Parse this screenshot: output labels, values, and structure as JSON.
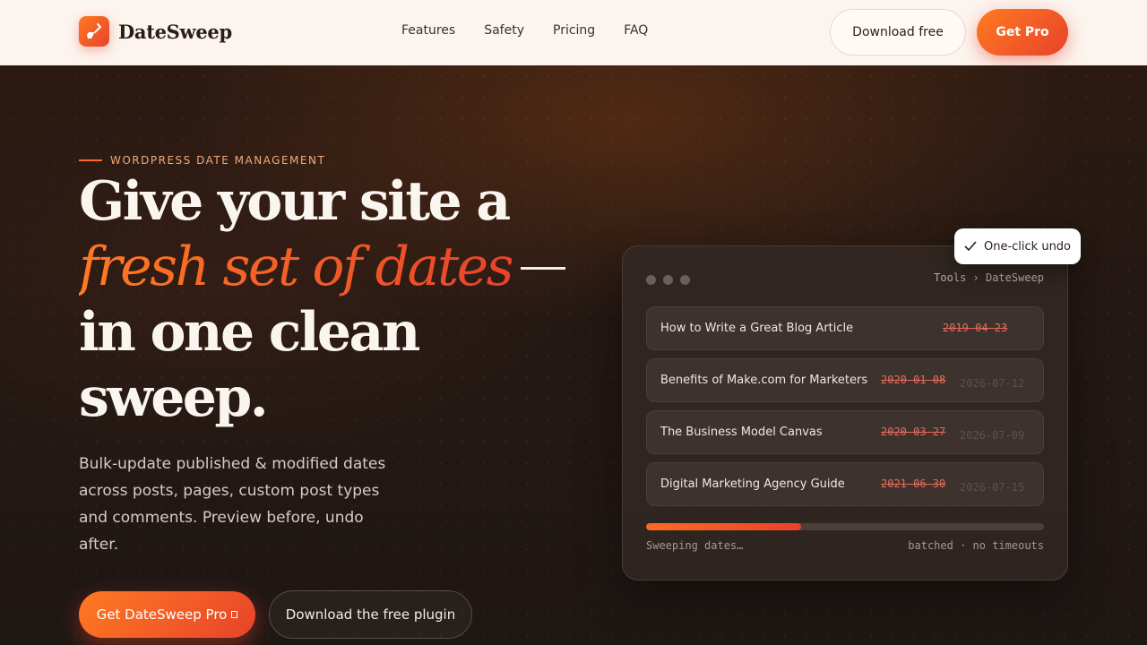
{
  "nav": {
    "brand": "DateSweep",
    "links": [
      "Features",
      "Safety",
      "Pricing",
      "FAQ"
    ],
    "download_label": "Download free",
    "pro_label": "Get Pro"
  },
  "hero": {
    "eyebrow": "WORDPRESS DATE MANAGEMENT",
    "headline_1": "Give your site a",
    "headline_accent": "fresh set of dates",
    "headline_2": "in one clean",
    "headline_3": "sweep.",
    "subtitle": "Bulk-update published & modified dates across posts, pages, custom post types and comments. Preview before, undo after.",
    "cta_primary": "Get DateSweep Pro",
    "cta_secondary": "Download the free plugin"
  },
  "app": {
    "breadcrumb": "Tools › DateSweep",
    "rows": [
      {
        "title": "How to Write a Great Blog Article",
        "old_date": "2019-04-23",
        "new_date": ""
      },
      {
        "title": "Benefits of Make.com for Marketers",
        "old_date": "2020-01-08",
        "new_date": "2026-07-12"
      },
      {
        "title": "The Business Model Canvas",
        "old_date": "2020-03-27",
        "new_date": "2026-07-09"
      },
      {
        "title": "Digital Marketing Agency Guide",
        "old_date": "2021-06-30",
        "new_date": "2026-07-15"
      }
    ],
    "progress": 0.39,
    "status_left": "Sweeping dates…",
    "status_right": "batched · no timeouts",
    "badge": "One-click undo"
  },
  "colors": {
    "accent_start": "#ff7a22",
    "accent_end": "#e7432a",
    "nav_bg": "#fcf4ee",
    "hero_bg": "#231814"
  }
}
